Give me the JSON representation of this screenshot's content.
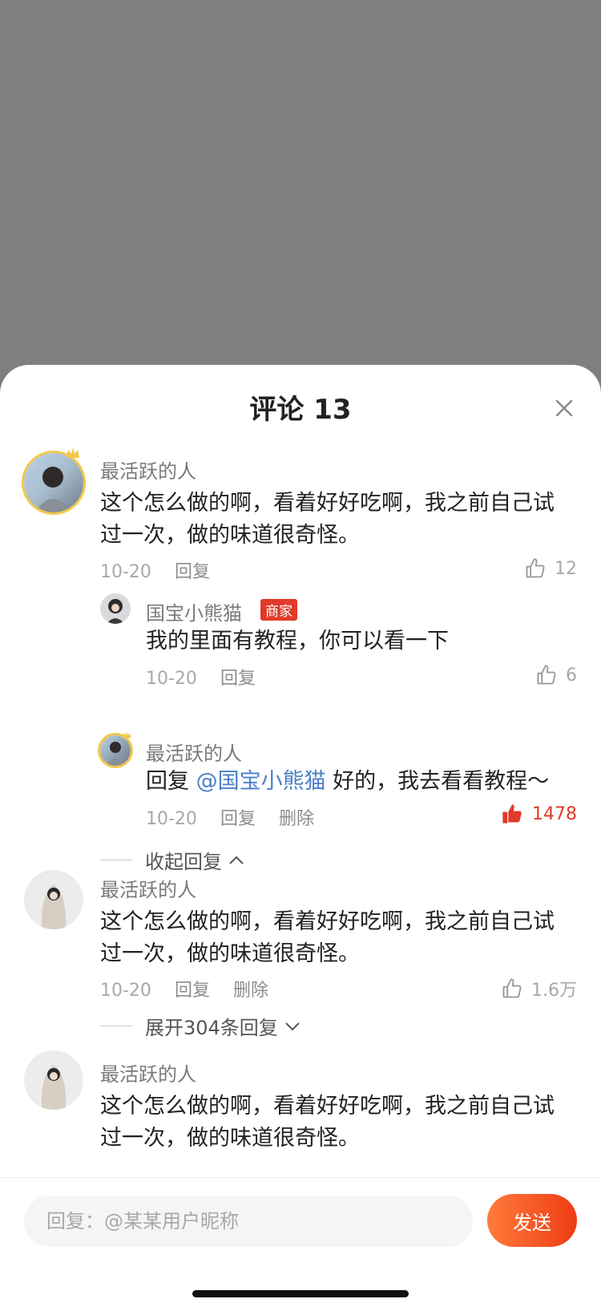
{
  "colors": {
    "accent": "#ee3c14",
    "like_active": "#e03a2a",
    "mention": "#4a7fc8",
    "badge": "#e03a2a"
  },
  "header": {
    "title": "评论 13",
    "close_icon": "close-icon"
  },
  "comments": [
    {
      "username": "最活跃的人",
      "text": "这个怎么做的啊，看着好好吃啊，我之前自己试过一次，做的味道很奇怪。",
      "date": "10-20",
      "reply_label": "回复",
      "likes": "12",
      "replies": [
        {
          "username": "国宝小熊猫",
          "badge": "商家",
          "text": "我的里面有教程，你可以看一下",
          "date": "10-20",
          "reply_label": "回复",
          "likes": "6"
        },
        {
          "username": "最活跃的人",
          "reply_prefix": "回复",
          "mention": "@国宝小熊猫",
          "text": "好的，我去看看教程～",
          "date": "10-20",
          "reply_label": "回复",
          "delete_label": "删除",
          "likes": "1478",
          "liked": true
        }
      ],
      "collapse_label": "收起回复"
    },
    {
      "username": "最活跃的人",
      "text": "这个怎么做的啊，看着好好吃啊，我之前自己试过一次，做的味道很奇怪。",
      "date": "10-20",
      "reply_label": "回复",
      "delete_label": "删除",
      "likes": "1.6万",
      "expand_label": "展开304条回复"
    },
    {
      "username": "最活跃的人",
      "text": "这个怎么做的啊，看着好好吃啊，我之前自己试过一次，做的味道很奇怪。"
    }
  ],
  "reply_bar": {
    "placeholder": "回复：@某某用户昵称",
    "send_label": "发送"
  }
}
